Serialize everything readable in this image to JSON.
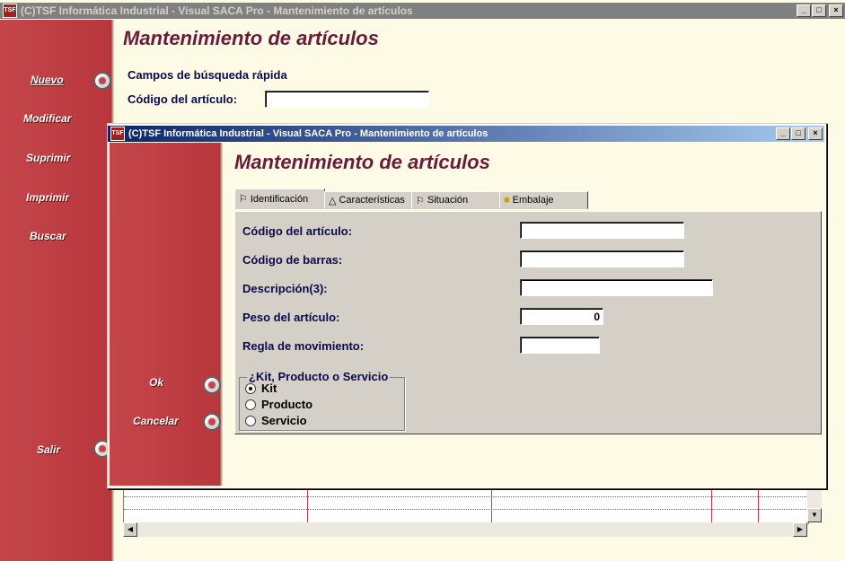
{
  "back_window": {
    "title": "(C)TSF Informática Industrial - Visual SACA Pro - Mantenimiento de artículos",
    "heading": "Mantenimiento de artículos",
    "nav": [
      "Nuevo",
      "Modificar",
      "Suprimir",
      "Imprimir",
      "Buscar",
      "Salir"
    ],
    "quick_search_label": "Campos de búsqueda rápida",
    "codigo_label": "Código del artículo:",
    "codigo_value": ""
  },
  "front_window": {
    "title": "(C)TSF Informática Industrial - Visual SACA Pro - Mantenimiento de artículos",
    "heading": "Mantenimiento de artículos",
    "tabs": [
      {
        "label": "Identificación",
        "icon": "signpost-icon"
      },
      {
        "label": "Características",
        "icon": "compass-icon"
      },
      {
        "label": "Situación",
        "icon": "signpost-icon"
      },
      {
        "label": "Embalaje",
        "icon": "box-icon"
      }
    ],
    "fields": {
      "codigo_label": "Código del artículo:",
      "codigo_value": "",
      "barras_label": "Código de barras:",
      "barras_value": "",
      "descripcion_label": "Descripción(3):",
      "descripcion_value": "",
      "peso_label": "Peso del artículo:",
      "peso_value": "0",
      "regla_label": "Regla de movimiento:",
      "regla_value": ""
    },
    "group": {
      "title": "¿Kit, Producto o Servicio",
      "options": [
        "Kit",
        "Producto",
        "Servicio"
      ],
      "selected": "Kit"
    },
    "buttons": {
      "ok": "Ok",
      "cancel": "Cancelar"
    }
  },
  "colors": {
    "sidebar_red": "#c4464b",
    "heading": "#6b1a3a",
    "label": "#0a0a50",
    "background": "#fdfbe6"
  }
}
